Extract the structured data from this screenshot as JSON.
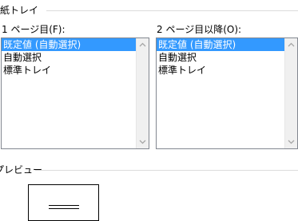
{
  "paper_tray_section": {
    "label": "用紙トレイ"
  },
  "first_page": {
    "label": "1 ページ目(F):",
    "items": [
      "既定値 (自動選択)",
      "自動選択",
      "標準トレイ"
    ],
    "selected_index": 0
  },
  "other_pages": {
    "label": "2 ページ目以降(O):",
    "items": [
      "既定値 (自動選択)",
      "自動選択",
      "標準トレイ"
    ],
    "selected_index": 0
  },
  "preview_section": {
    "label": "プレビュー"
  },
  "icons": {
    "scroll_up": "chevron-up-icon",
    "scroll_down": "chevron-down-icon"
  },
  "colors": {
    "selection": "#3399ff",
    "list_border": "#828790",
    "scrollbar_track": "#f0f0f0",
    "separator": "#dcdcdc"
  }
}
